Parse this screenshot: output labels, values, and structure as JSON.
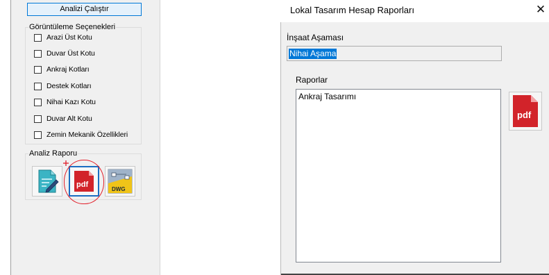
{
  "left_panel": {
    "run_button": "Analizi Çalıştır",
    "display_options": {
      "legend": "Görüntüleme Seçenekleri",
      "items": [
        {
          "label": "Arazi Üst Kotu",
          "checked": false
        },
        {
          "label": "Duvar Üst Kotu",
          "checked": false
        },
        {
          "label": "Ankraj  Kotları",
          "checked": false
        },
        {
          "label": "Destek Kotları",
          "checked": false
        },
        {
          "label": "Nihai Kazı Kotu",
          "checked": false
        },
        {
          "label": "Duvar Alt Kotu",
          "checked": false
        },
        {
          "label": "Zemin Mekanik Özellikleri",
          "checked": false
        }
      ]
    },
    "analysis_report": {
      "legend": "Analiz Raporu",
      "buttons": [
        {
          "icon": "edit-report-icon"
        },
        {
          "icon": "pdf-icon",
          "label": "pdf"
        },
        {
          "icon": "dwg-icon",
          "label": "DWG"
        }
      ]
    }
  },
  "dialog": {
    "title": "Lokal Tasarım Hesap Raporları",
    "close_glyph": "✕",
    "stage_label": "İnşaat Aşaması",
    "stage_value": "Nihai Aşama",
    "reports_label": "Raporlar",
    "reports": [
      "Ankraj Tasarımı"
    ],
    "pdf_label": "pdf"
  },
  "colors": {
    "accent": "#0078d7",
    "pdf_red": "#d2232a",
    "annotation_red": "#e21f2a"
  }
}
